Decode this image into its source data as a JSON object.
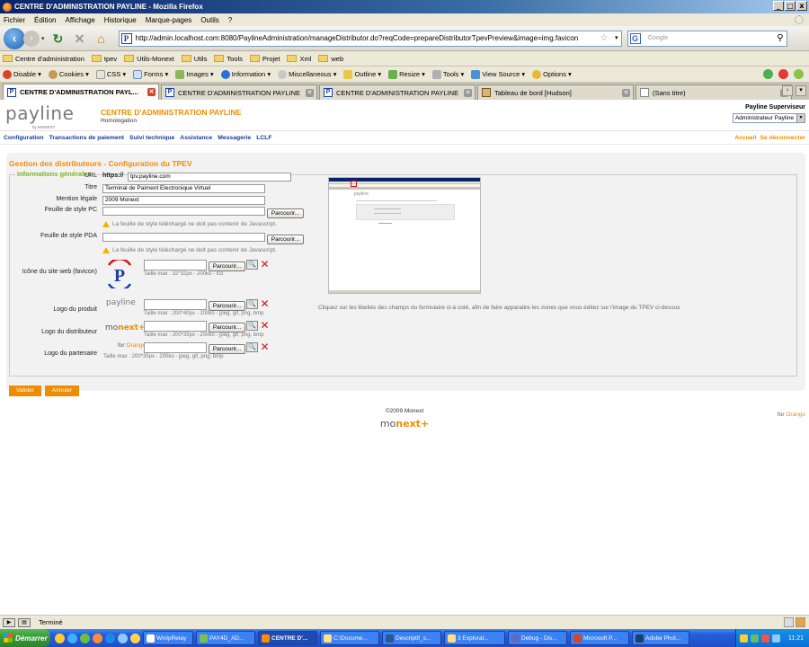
{
  "window": {
    "title": "CENTRE D'ADMINISTRATION PAYLINE - Mozilla Firefox",
    "buttons": [
      "_",
      "□",
      "x"
    ]
  },
  "menu": [
    "Fichier",
    "Édition",
    "Affichage",
    "Historique",
    "Marque-pages",
    "Outils",
    "?"
  ],
  "nav": {
    "url": "http://admin.localhost.com:8080/PaylineAdministration/manageDistributor.do?reqCode=prepareDistributorTpevPreview&image=img.favicon",
    "search_placeholder": "Google"
  },
  "bookmarks": [
    "Centre d'administration",
    "tpev",
    "Utils-Monext",
    "Utils",
    "Tools",
    "Projet",
    "Xml",
    "web"
  ],
  "devbar": [
    "Disable",
    "Cookies",
    "CSS",
    "Forms",
    "Images",
    "Information",
    "Miscellaneous",
    "Outline",
    "Resize",
    "Tools",
    "View Source",
    "Options"
  ],
  "tabs": [
    {
      "label": "CENTRE D'ADMINISTRATION PAYL...",
      "fav": "P"
    },
    {
      "label": "CENTRE D'ADMINISTRATION PAYLINE",
      "fav": "P"
    },
    {
      "label": "CENTRE D'ADMINISTRATION PAYLINE",
      "fav": "P"
    },
    {
      "label": "Tableau de bord [Hudson]",
      "fav": ""
    },
    {
      "label": "(Sans titre)",
      "fav": ""
    }
  ],
  "site": {
    "logo": "payline",
    "logo_sub": "by MONEXT",
    "title": "CENTRE D'ADMINISTRATION PAYLINE",
    "env": "Homologation",
    "user_role": "Payline Superviseur",
    "user_select": "Administrateur Payline",
    "nav": [
      "Configuration",
      "Transactions de paiement",
      "Suivi technique",
      "Assistance",
      "Messagerie",
      "LCLF"
    ],
    "nav_right": [
      "Accueil",
      "Se déconnecter"
    ]
  },
  "form": {
    "page_title": "Gestion des distributeurs - Configuration du TPEV",
    "legend": "Informations générales",
    "url_label": "URL",
    "url_prefix": "https://",
    "url_value": "tpv.payline.com",
    "titre_label": "Titre",
    "titre_value": "Terminal de Paiment Electronique Virtuel",
    "mention_label": "Mention légale",
    "mention_value": "2009 Monext",
    "css_pc_label": "Feuille de style PC",
    "css_pda_label": "Feuille de style PDA",
    "browse": "Parcourir...",
    "css_warning": "La feuille de style téléchargé ne doit pas contenir de Javascript.",
    "favicon_label": "Icône du site web (favicon)",
    "favicon_hint": "Taille max : 32*32px - 200ko - ico",
    "logo_produit_label": "Logo du produit",
    "logo_produit_hint": "Taille max : 200*40px - 200ko - jpeg, gif, png, bmp",
    "logo_distrib_label": "Logo du distributeur",
    "logo_distrib_hint": "Taille max : 200*35px - 200ko - jpeg, gif, png, bmp",
    "logo_partner_label": "Logo du partenaire",
    "logo_partner_hint": "Taille max : 200*35px - 200ko - jpeg, gif, png, bmp",
    "info": "Cliquez sur les libellés des champs du formulaire ci-à coté, afin de faire apparaitre les zones que vous éditez sur l'image du TPEV ci-dessus",
    "validate": "Valider",
    "cancel": "Annuler",
    "preview_logo": "payline",
    "logo_payline": "payline",
    "logo_monext_a": "mo",
    "logo_monext_b": "next",
    "logo_monext_c": "+",
    "logo_for": "for",
    "logo_orange": "Orange"
  },
  "footer": {
    "copyright": "©2009 Monext",
    "logo_a": "mo",
    "logo_b": "next",
    "logo_c": "+",
    "for": "for",
    "orange": "Orange"
  },
  "status": "Terminé",
  "taskbar": {
    "start": "Démarrer",
    "tasks": [
      "WinIpRelay",
      "PAY4D_AD...",
      "CENTRE D'...",
      "C:\\Docume...",
      "Descriptif_s...",
      "3 Explorat...",
      "Debug - Dis...",
      "Microsoft P...",
      "Adobe Phot..."
    ],
    "clock": "11:21"
  },
  "colors": {
    "accent": "#f08c00",
    "nav_link": "#1a3a8c",
    "legend": "#7ab31f",
    "delete": "#d4121a"
  }
}
